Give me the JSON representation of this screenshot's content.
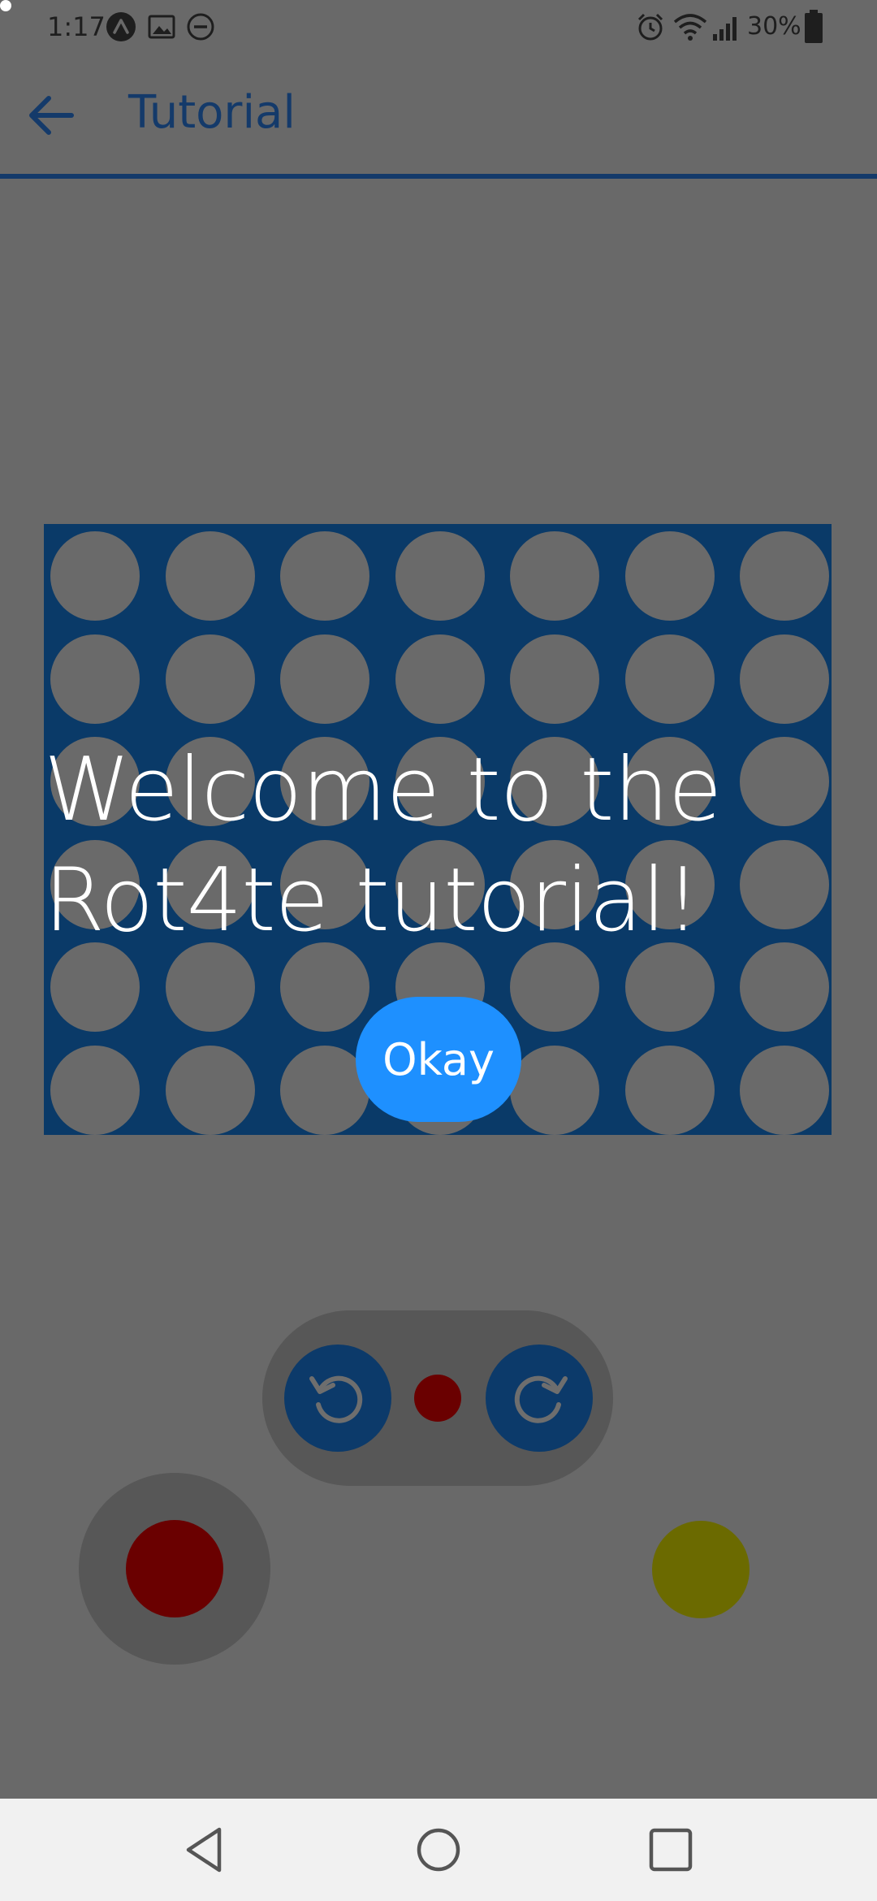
{
  "status_bar": {
    "time": "1:17",
    "battery_percent": "30%",
    "icons": [
      "app-notification-icon",
      "image-icon",
      "do-not-disturb-icon",
      "alarm-icon",
      "wifi-icon",
      "signal-icon",
      "battery-icon"
    ]
  },
  "app_bar": {
    "title": "Tutorial",
    "back_icon": "arrow-back-icon"
  },
  "board": {
    "rows": 6,
    "columns": 7
  },
  "tutorial": {
    "message_line1": "Welcome to the",
    "message_line2": "Rot4te tutorial!",
    "okay_label": "Okay"
  },
  "controls": {
    "rotate_left_icon": "rotate-counterclockwise-icon",
    "rotate_right_icon": "rotate-clockwise-icon"
  },
  "colors": {
    "board": "#0a3a68",
    "player1": "#6a0000",
    "player2": "#6b6a00",
    "accent": "#1e90ff",
    "overlay": "#696969"
  },
  "nav_bar": {
    "icons": [
      "back-triangle-icon",
      "home-circle-icon",
      "recents-square-icon"
    ]
  }
}
